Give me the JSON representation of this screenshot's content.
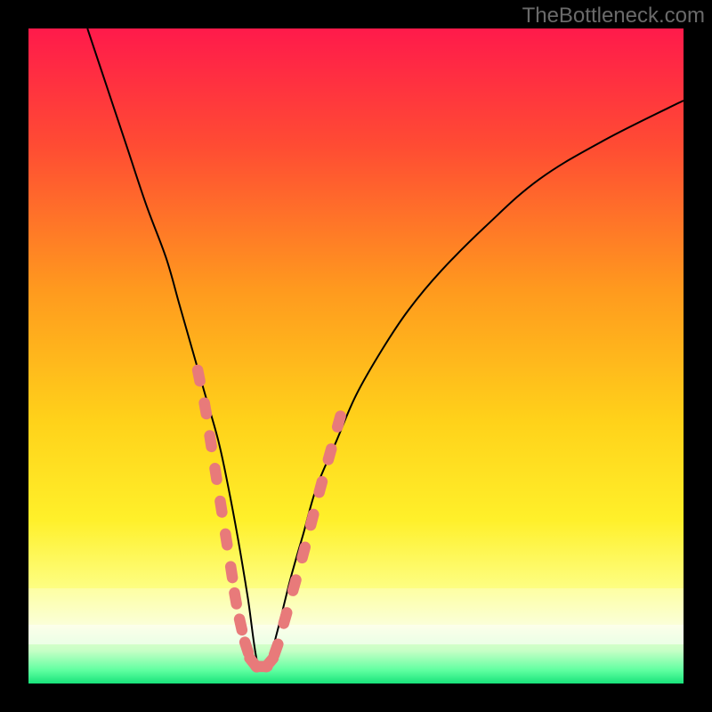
{
  "watermark": {
    "text": "TheBottleneck.com"
  },
  "colors": {
    "black": "#000000",
    "curve": "#000000",
    "marker": "#e87a7a",
    "gradient_stops": [
      {
        "pct": 0,
        "color": "#ff1a4b"
      },
      {
        "pct": 18,
        "color": "#ff4c33"
      },
      {
        "pct": 40,
        "color": "#ff9a1e"
      },
      {
        "pct": 60,
        "color": "#ffd21a"
      },
      {
        "pct": 75,
        "color": "#fff02a"
      },
      {
        "pct": 86,
        "color": "#fdff87"
      },
      {
        "pct": 91,
        "color": "#faffd0"
      },
      {
        "pct": 95,
        "color": "#c6ffc6"
      },
      {
        "pct": 98,
        "color": "#5fffa0"
      },
      {
        "pct": 100,
        "color": "#18e27a"
      }
    ],
    "bottom_bands": [
      {
        "top_pct": 85.5,
        "height_pct": 5.5,
        "color": "rgba(253,255,230,0.35)"
      },
      {
        "top_pct": 91.0,
        "height_pct": 3.0,
        "color": "rgba(255,255,255,0.55)"
      }
    ]
  },
  "chart_data": {
    "type": "line",
    "title": "",
    "xlabel": "",
    "ylabel": "",
    "xlim": [
      0,
      100
    ],
    "ylim": [
      0,
      100
    ],
    "grid": false,
    "legend": false,
    "note": "x and y are in plot-percent units (0..100). Curve is a V-shaped bottleneck profile with a minimum near x≈35; left arm rises steeply, right arm rises more gently.",
    "series": [
      {
        "name": "bottleneck-curve",
        "x": [
          9,
          12,
          15,
          18,
          21,
          23,
          25,
          27,
          29,
          30.5,
          32,
          33.5,
          35,
          36.5,
          38,
          40,
          42,
          44,
          47,
          50,
          54,
          58,
          63,
          70,
          78,
          88,
          100
        ],
        "y": [
          100,
          91,
          82,
          73,
          65,
          58,
          51,
          44,
          37,
          30,
          22,
          13,
          3,
          3,
          8,
          16,
          23,
          30,
          37,
          44,
          51,
          57,
          63,
          70,
          77,
          83,
          89
        ]
      }
    ],
    "markers": {
      "name": "highlighted-segments",
      "shape": "rounded-capsule",
      "color_ref": "marker",
      "points": [
        {
          "x": 26.0,
          "y": 47
        },
        {
          "x": 27.0,
          "y": 42
        },
        {
          "x": 27.8,
          "y": 37
        },
        {
          "x": 28.6,
          "y": 32
        },
        {
          "x": 29.4,
          "y": 27
        },
        {
          "x": 30.2,
          "y": 22
        },
        {
          "x": 31.0,
          "y": 17
        },
        {
          "x": 31.6,
          "y": 13
        },
        {
          "x": 32.4,
          "y": 9
        },
        {
          "x": 33.3,
          "y": 5.5
        },
        {
          "x": 34.3,
          "y": 3.2
        },
        {
          "x": 35.6,
          "y": 2.6
        },
        {
          "x": 36.8,
          "y": 3.2
        },
        {
          "x": 37.8,
          "y": 5.2
        },
        {
          "x": 39.2,
          "y": 10
        },
        {
          "x": 40.6,
          "y": 15
        },
        {
          "x": 42.0,
          "y": 20
        },
        {
          "x": 43.3,
          "y": 25
        },
        {
          "x": 44.6,
          "y": 30
        },
        {
          "x": 46.0,
          "y": 35
        },
        {
          "x": 47.4,
          "y": 40
        }
      ]
    }
  }
}
